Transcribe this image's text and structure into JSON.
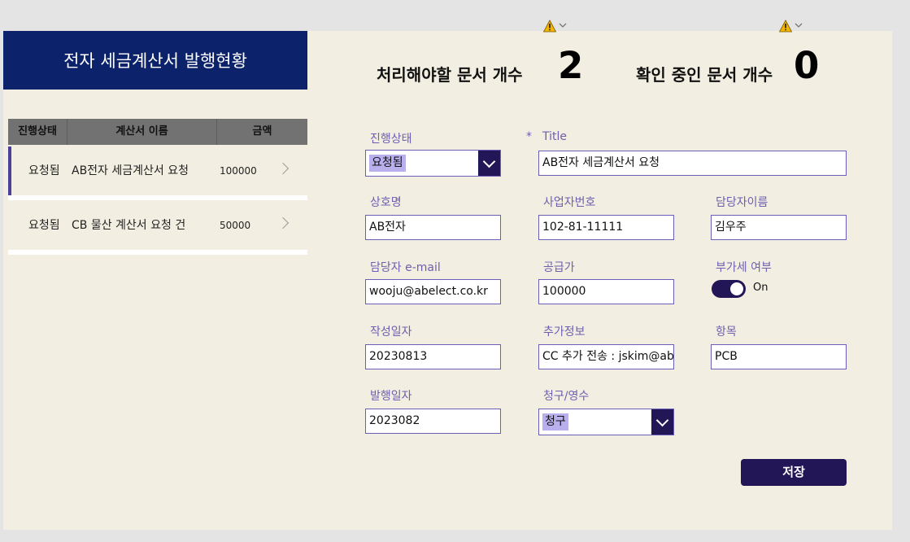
{
  "app": {
    "title": "전자 세금계산서 발행현황"
  },
  "list": {
    "headers": [
      "진행상태",
      "계산서 이름",
      "금액"
    ],
    "rows": [
      {
        "status": "요청됨",
        "name": "AB전자 세금계산서 요청",
        "amount": "100000"
      },
      {
        "status": "요청됨",
        "name": "CB 물산 계산서 요청 건",
        "amount": "50000"
      }
    ]
  },
  "counters": {
    "todo_label": "처리해야할 문서 개수",
    "todo_value": "2",
    "review_label": "확인 중인 문서 개수",
    "review_value": "0"
  },
  "form": {
    "status": {
      "label": "진행상태",
      "value": "요청됨"
    },
    "title": {
      "required_mark": "*",
      "label": "Title",
      "value": "AB전자 세금계산서 요청"
    },
    "company": {
      "label": "상호명",
      "value": "AB전자"
    },
    "biz_no": {
      "label": "사업자번호",
      "value": "102-81-11111"
    },
    "manager": {
      "label": "담당자이름",
      "value": "김우주"
    },
    "email": {
      "label": "담당자 e-mail",
      "value": "wooju@abelect.co.kr"
    },
    "supply": {
      "label": "공급가",
      "value": "100000"
    },
    "vat": {
      "label": "부가세 여부",
      "value": "On"
    },
    "created": {
      "label": "작성일자",
      "value": "20230813"
    },
    "extra": {
      "label": "추가정보",
      "value": "CC 추가 전송 : jskim@abelect.co.kr"
    },
    "item": {
      "label": "항목",
      "value": "PCB"
    },
    "issued": {
      "label": "발행일자",
      "value": "2023082"
    },
    "claim": {
      "label": "청구/영수",
      "value": "청구"
    },
    "save_label": "저장"
  },
  "icons": {
    "warning": "warning-icon",
    "expand": "chevron-down-icon"
  },
  "colors": {
    "navy": "#0c226b",
    "accent": "#231656",
    "border": "#6b5eb8",
    "canvas": "#f2eee1"
  }
}
